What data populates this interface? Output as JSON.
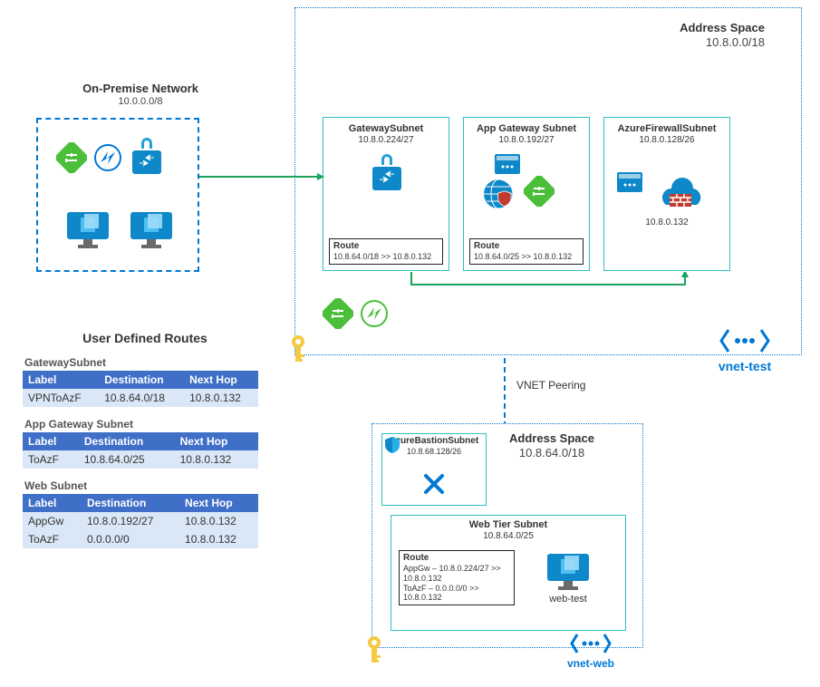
{
  "onprem": {
    "title": "On-Premise Network",
    "cidr": "10.0.0.0/8"
  },
  "vnet_test": {
    "address_space_title": "Address Space",
    "address_space_cidr": "10.8.0.0/18",
    "name": "vnet-test",
    "subnets": {
      "gateway": {
        "title": "GatewaySubnet",
        "cidr": "10.8.0.224/27",
        "route_title": "Route",
        "route_text": "10.8.64.0/18 >> 10.8.0.132"
      },
      "appgw": {
        "title": "App Gateway Subnet",
        "cidr": "10.8.0.192/27",
        "route_title": "Route",
        "route_text": "10.8.64.0/25 >> 10.8.0.132"
      },
      "firewall": {
        "title": "AzureFirewallSubnet",
        "cidr": "10.8.0.128/26",
        "ip": "10.8.0.132"
      }
    }
  },
  "vnet_web": {
    "address_space_title": "Address Space",
    "address_space_cidr": "10.8.64.0/18",
    "name": "vnet-web",
    "bastion": {
      "title": "AzureBastionSubnet",
      "cidr": "10.8.68.128/26"
    },
    "web": {
      "title": "Web Tier Subnet",
      "cidr": "10.8.64.0/25",
      "route_title": "Route",
      "route_line1": "AppGw – 10.8.0.224/27 >> 10.8.0.132",
      "route_line2": "ToAzF – 0.0.0.0/0 >> 10.8.0.132",
      "vm": "web-test"
    }
  },
  "peering_label": "VNET Peering",
  "routes": {
    "heading": "User Defined Routes",
    "tables": [
      {
        "caption": "GatewaySubnet",
        "headers": [
          "Label",
          "Destination",
          "Next Hop"
        ],
        "rows": [
          [
            "VPNToAzF",
            "10.8.64.0/18",
            "10.8.0.132"
          ]
        ]
      },
      {
        "caption": "App Gateway Subnet",
        "headers": [
          "Label",
          "Destination",
          "Next Hop"
        ],
        "rows": [
          [
            "ToAzF",
            "10.8.64.0/25",
            "10.8.0.132"
          ]
        ]
      },
      {
        "caption": "Web Subnet",
        "headers": [
          "Label",
          "Destination",
          "Next Hop"
        ],
        "rows": [
          [
            "AppGw",
            "10.8.0.192/27",
            "10.8.0.132"
          ],
          [
            "ToAzF",
            "0.0.0.0/0",
            "10.8.0.132"
          ]
        ]
      }
    ]
  }
}
